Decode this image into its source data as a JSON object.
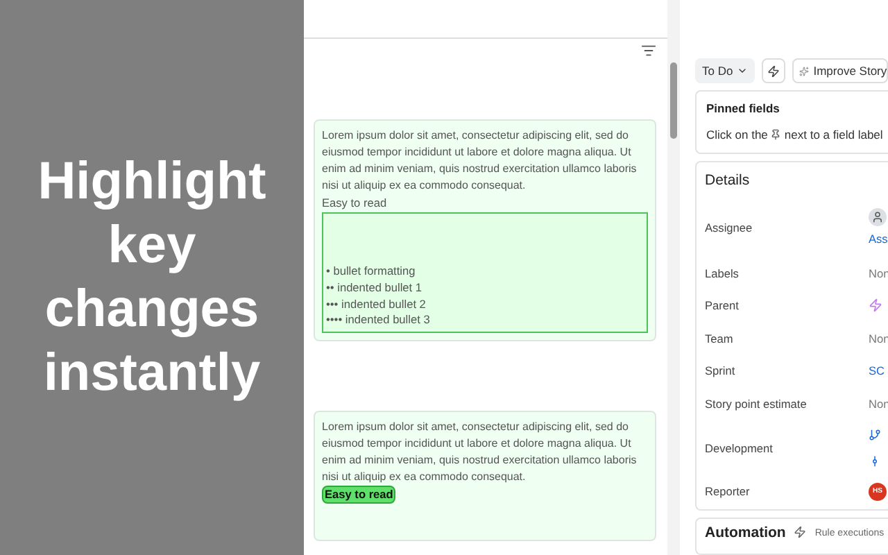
{
  "promo": {
    "headline": "Highlight key changes instantly"
  },
  "cards": [
    {
      "paragraph": "Lorem ipsum dolor sit amet, consectetur adipiscing elit, sed do eiusmod tempor incididunt ut labore et dolore magna aliqua. Ut enim ad minim veniam, quis nostrud exercitation ullamco laboris nisi ut aliquip ex ea commodo consequat.",
      "note": "Easy to read",
      "highlighted": false,
      "bullets": [
        "• bullet formatting",
        "•• indented bullet 1",
        "••• indented bullet 2",
        "•••• indented bullet 3"
      ]
    },
    {
      "paragraph": "Lorem ipsum dolor sit amet, consectetur adipiscing elit, sed do eiusmod tempor incididunt ut labore et dolore magna aliqua. Ut enim ad minim veniam, quis nostrud exercitation ullamco laboris nisi ut aliquip ex ea commodo consequat.",
      "note": "Easy to read",
      "highlighted": true
    }
  ],
  "toolbar": {
    "status": "To Do",
    "improve": "Improve Story"
  },
  "pinned": {
    "title": "Pinned fields",
    "hint_before": "Click on the",
    "hint_after": "next to a field label"
  },
  "details": {
    "title": "Details",
    "fields": [
      {
        "label": "Assignee",
        "kind": "person",
        "value": "Ass"
      },
      {
        "label": "Labels",
        "kind": "text",
        "value": "Non"
      },
      {
        "label": "Parent",
        "kind": "parent"
      },
      {
        "label": "Team",
        "kind": "text",
        "value": "Non"
      },
      {
        "label": "Sprint",
        "kind": "link",
        "value": "SC"
      },
      {
        "label": "Story point estimate",
        "kind": "text",
        "value": "Non"
      },
      {
        "label": "Development",
        "kind": "dev"
      },
      {
        "label": "Reporter",
        "kind": "avatar",
        "value": "HS"
      }
    ]
  },
  "automation": {
    "title": "Automation",
    "subtitle": "Rule executions"
  }
}
